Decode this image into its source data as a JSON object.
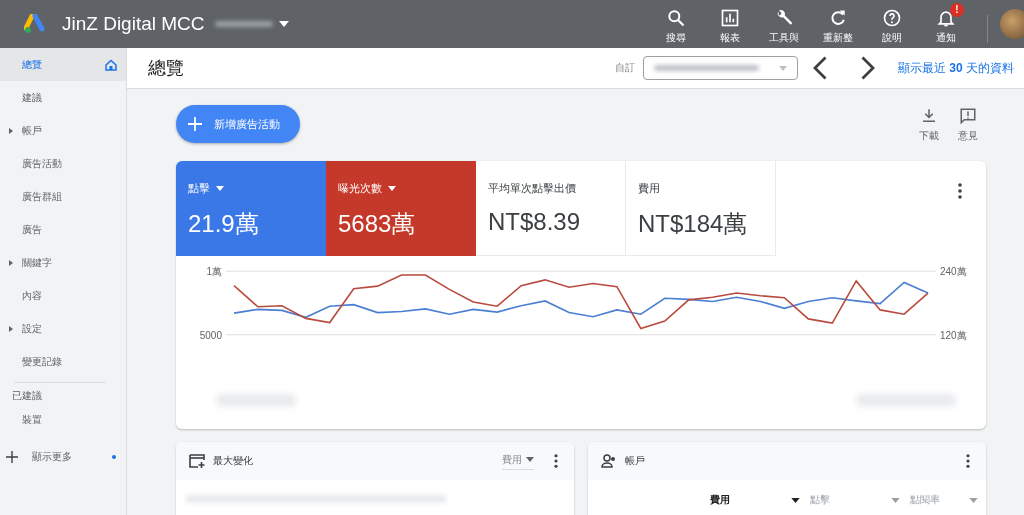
{
  "top_bar": {
    "account_name": "JinZ Digital MCC",
    "actions": [
      {
        "kind": "search",
        "label": "搜尋"
      },
      {
        "kind": "report",
        "label": "報表"
      },
      {
        "kind": "tools",
        "label": "工具與"
      },
      {
        "kind": "refresh",
        "label": "重新整"
      },
      {
        "kind": "help",
        "label": "說明"
      },
      {
        "kind": "bell",
        "label": "通知",
        "badge": "!"
      }
    ]
  },
  "sidebar": {
    "items": [
      {
        "label": "總覽",
        "expandable": false,
        "selected": true
      },
      {
        "label": "建議",
        "expandable": false,
        "selected": false
      },
      {
        "label": "帳戶",
        "expandable": true,
        "selected": false
      },
      {
        "label": "廣告活動",
        "expandable": false,
        "selected": false
      },
      {
        "label": "廣告群組",
        "expandable": false,
        "selected": false
      },
      {
        "label": "廣告",
        "expandable": false,
        "selected": false
      },
      {
        "label": "關鍵字",
        "expandable": true,
        "selected": false
      },
      {
        "label": "內容",
        "expandable": false,
        "selected": false
      },
      {
        "label": "設定",
        "expandable": true,
        "selected": false
      },
      {
        "label": "變更記錄",
        "expandable": false,
        "selected": false
      }
    ],
    "section_label": "已建議",
    "section_items": [
      {
        "label": "裝置",
        "selected": false
      }
    ],
    "show_more": {
      "label": "顯示更多"
    }
  },
  "header": {
    "title": "總覽",
    "date_label": "自訂",
    "show_recent": {
      "before": "顯示最近 ",
      "number": "30",
      "after": " 天的資料"
    }
  },
  "new_campaign_button": "新增廣告活動",
  "tools": [
    {
      "kind": "download",
      "label": "下載"
    },
    {
      "kind": "feedback",
      "label": "意見"
    }
  ],
  "metrics": [
    {
      "label": "點擊",
      "value": "21.9萬",
      "selected": true,
      "color": "#3b78e7"
    },
    {
      "label": "曝光次數",
      "value": "5683萬",
      "selected": true,
      "color": "#c5392a"
    },
    {
      "label": "平均單次點擊出價",
      "value": "NT$8.39",
      "selected": false
    },
    {
      "label": "費用",
      "value": "NT$184萬",
      "selected": false
    }
  ],
  "trend_chart": {
    "left_axis": [
      "1萬",
      "5000"
    ],
    "right_axis": [
      "240萬",
      "120萬"
    ]
  },
  "cards": [
    {
      "kind": "changes",
      "title": "最大變化",
      "dropdown": "費用"
    },
    {
      "kind": "accounts",
      "title": "帳戶",
      "columns": [
        {
          "label": "費用",
          "selected": true
        },
        {
          "label": "點擊",
          "selected": false
        },
        {
          "label": "點閱率",
          "selected": false
        }
      ]
    }
  ]
}
